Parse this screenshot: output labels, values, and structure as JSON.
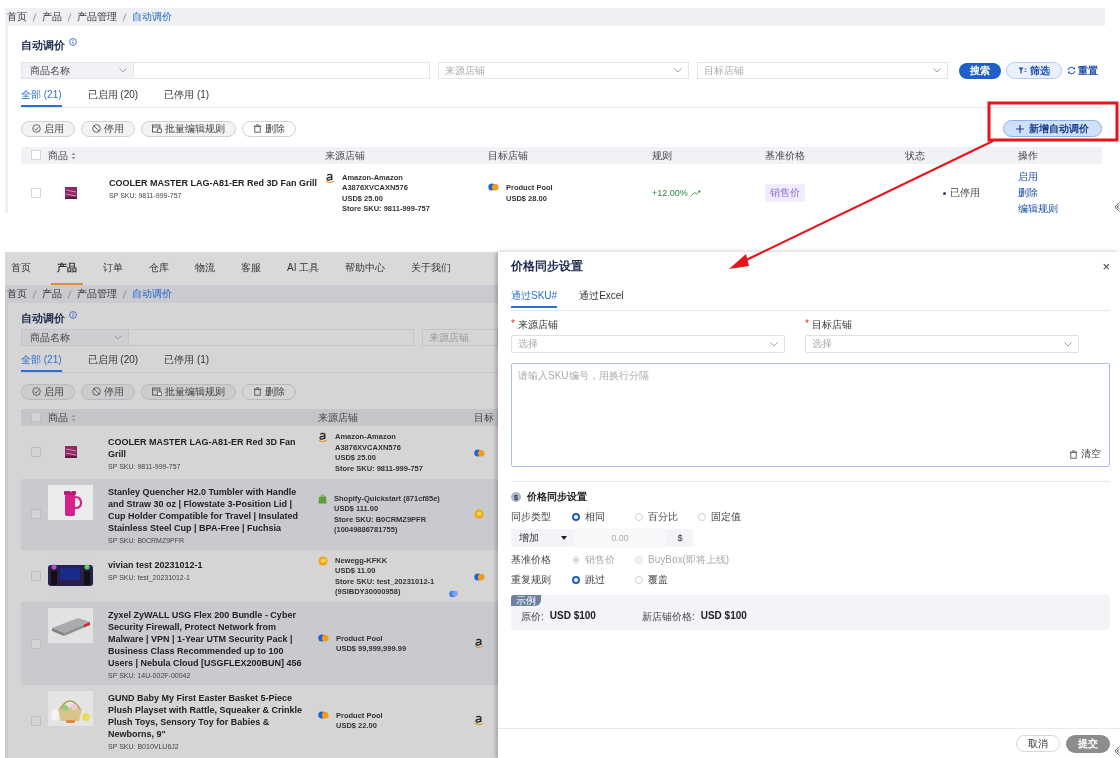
{
  "top": {
    "breadcrumb": [
      "首页",
      "产品",
      "产品管理",
      "自动调价"
    ],
    "title": "自动调价",
    "filters": {
      "field": "商品名称",
      "source_placeholder": "来源店铺",
      "target_placeholder": "目标店铺"
    },
    "search": "搜索",
    "filter": "筛选",
    "reset": "重置",
    "tabs": [
      {
        "label": "全部 (21)",
        "selected": true
      },
      {
        "label": "已启用 (20)",
        "selected": false
      },
      {
        "label": "已停用 (1)",
        "selected": false
      }
    ],
    "actions": [
      "启用",
      "停用",
      "批量编辑规则",
      "删除"
    ],
    "add": "新增自动调价",
    "columns": [
      "商品",
      "来源店铺",
      "目标店铺",
      "规则",
      "基准价格",
      "状态",
      "操作"
    ],
    "header_checked": false,
    "rows": [
      {
        "checked": false,
        "title": "COOLER MASTER LAG-A81-ER Red 3D Fan Grill",
        "sku": "SP SKU: 9811-999-757",
        "source": {
          "kind": "amazon",
          "lines": [
            "Amazon-Amazon",
            "A3876XVCAXN576",
            "USD$ 25.00",
            "Store SKU: 9811-999-757"
          ]
        },
        "target": {
          "kind": "pool",
          "lines": [
            "Product Pool",
            "USD$ 28.00"
          ]
        },
        "rule": "+12.00%",
        "base": "销售价",
        "status": "已停用",
        "ops": [
          "启用",
          "删除",
          "编辑规则"
        ]
      }
    ]
  },
  "bottom": {
    "nav": [
      {
        "label": "首页",
        "selected": false
      },
      {
        "label": "产品",
        "selected": true
      },
      {
        "label": "订单",
        "selected": false
      },
      {
        "label": "仓库",
        "selected": false
      },
      {
        "label": "物流",
        "selected": false
      },
      {
        "label": "客服",
        "selected": false
      },
      {
        "label": "AI 工具",
        "selected": false
      },
      {
        "label": "帮助中心",
        "selected": false
      },
      {
        "label": "关于我们",
        "selected": false
      }
    ],
    "breadcrumb": [
      "首页",
      "产品",
      "产品管理",
      "自动调价"
    ],
    "title": "自动调价",
    "filters": {
      "field": "商品名称",
      "source_placeholder": "来源店铺"
    },
    "tabs": [
      {
        "label": "全部 (21)",
        "selected": true
      },
      {
        "label": "已启用 (20)",
        "selected": false
      },
      {
        "label": "已停用 (1)",
        "selected": false
      }
    ],
    "actions": [
      "启用",
      "停用",
      "批量编辑规则",
      "删除"
    ],
    "columns": [
      "商品",
      "来源店铺",
      "目标"
    ],
    "header_checked": false,
    "rows": [
      {
        "checked": false,
        "title": "COOLER MASTER LAG-A81-ER Red 3D Fan Grill",
        "sku": "SP SKU: 9811-999-757",
        "source": {
          "kind": "amazon",
          "lines": [
            "Amazon-Amazon",
            "A3876XVCAXN576",
            "USD$ 25.00",
            "Store SKU: 9811-999-757"
          ]
        },
        "target": {
          "kind": "pool"
        },
        "tag_icon": false
      },
      {
        "checked": false,
        "title": "Stanley Quencher H2.0 Tumbler with Handle and Straw 30 oz | Flowstate 3-Position Lid | Cup Holder Compatible for Travel | Insulated Stainless Steel Cup | BPA-Free | Fuchsia",
        "sku": "SP SKU: B0CRMZ9PFR",
        "source": {
          "kind": "shopify",
          "lines": [
            "Shopify-Quickstart (871cf85e)",
            "USD$ 111.00",
            "Store SKU: B0CRMZ9PFR",
            "(10049886781755)"
          ]
        },
        "target": {
          "kind": "newegg"
        },
        "tag_icon": false
      },
      {
        "checked": false,
        "title": "vivian test 20231012-1",
        "sku": "SP SKU: test_20231012-1",
        "source": {
          "kind": "newegg",
          "lines": [
            "Newegg-KFKK",
            "USD$ 11.00",
            "Store SKU: test_20231012-1",
            "(9SIBDY30000958)"
          ]
        },
        "target": {
          "kind": "pool"
        },
        "tag_icon": true
      },
      {
        "checked": false,
        "title": "Zyxel ZyWALL USG Flex 200 Bundle - Cyber Security Firewall, Protect Network from Malware | VPN | 1-Year UTM Security Pack | Business Class Recommended up to 100 Users | Nebula Cloud [USGFLEX200BUN] 456",
        "sku": "SP SKU: 14U-002F-00042",
        "source": {
          "kind": "pool",
          "lines": [
            "Product Pool",
            "USD$ 99,999,999.99"
          ]
        },
        "target": {
          "kind": "amazon"
        },
        "tag_icon": false
      },
      {
        "checked": false,
        "title": "GUND Baby My First Easter Basket 5-Piece Plush Playset with Rattle, Squeaker & Crinkle Plush Toys, Sensory Toy for Babies & Newborns, 9\"",
        "sku": "SP SKU: B010VLU6J2",
        "source": {
          "kind": "pool",
          "lines": [
            "Product Pool",
            "USD$ 22.00"
          ]
        },
        "target": {
          "kind": "amazon"
        },
        "tag_icon": false
      }
    ]
  },
  "drawer": {
    "title": "价格同步设置",
    "close": "×",
    "tabs": [
      {
        "label": "通过SKU#",
        "selected": true
      },
      {
        "label": "通过Excel",
        "selected": false
      }
    ],
    "fields": [
      {
        "required_mark": "*",
        "label": "来源店铺",
        "placeholder": "选择"
      },
      {
        "required_mark": "*",
        "label": "目标店铺",
        "placeholder": "选择"
      }
    ],
    "sku_placeholder": "请输入SKU编号，用换行分隔",
    "clear": "清空",
    "section_icon": "$",
    "section_title": "价格同步设置",
    "sync_type": {
      "label": "同步类型",
      "options": [
        {
          "label": "相同",
          "selected": true,
          "disabled": false
        },
        {
          "label": "百分比",
          "selected": false,
          "disabled": false
        },
        {
          "label": "固定值",
          "selected": false,
          "disabled": false
        }
      ]
    },
    "adjust": {
      "mode": "增加",
      "placeholder": "0.00",
      "unit": "$"
    },
    "base_price": {
      "label": "基准价格",
      "options": [
        {
          "label": "销售价",
          "selected": true,
          "disabled": true
        },
        {
          "label": "BuyBox(即将上线)",
          "selected": false,
          "disabled": true
        }
      ]
    },
    "repeat_rule": {
      "label": "重复规则",
      "options": [
        {
          "label": "跳过",
          "selected": true,
          "disabled": false
        },
        {
          "label": "覆盖",
          "selected": false,
          "disabled": false
        }
      ]
    },
    "example": {
      "tag": "示例",
      "items": [
        {
          "label": "原价:",
          "value": "USD $100"
        },
        {
          "label": "新店铺价格:",
          "value": "USD $100"
        }
      ]
    },
    "cancel": "取消",
    "submit": {
      "label": "提交",
      "disabled": true
    }
  }
}
